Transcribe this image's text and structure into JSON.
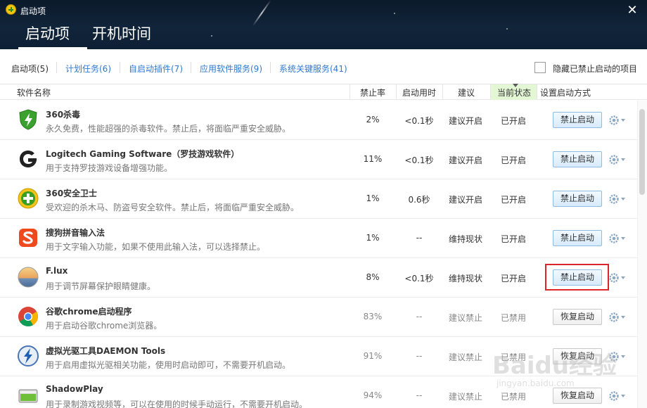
{
  "window": {
    "title": "启动项",
    "tabs": [
      {
        "label": "启动项",
        "active": true
      },
      {
        "label": "开机时间",
        "active": false
      }
    ]
  },
  "subtabs": [
    {
      "label": "启动项(5)",
      "active": true
    },
    {
      "label": "计划任务(6)",
      "active": false
    },
    {
      "label": "自启动插件(7)",
      "active": false
    },
    {
      "label": "应用软件服务(9)",
      "active": false
    },
    {
      "label": "系统关键服务(41)",
      "active": false
    }
  ],
  "hide_disabled": {
    "label": "隐藏已禁止启动的项目",
    "checked": false
  },
  "columns": {
    "name": "软件名称",
    "rate": "禁止率",
    "time": "启动用时",
    "advice": "建议",
    "state": "当前状态",
    "action": "设置启动方式"
  },
  "rows": [
    {
      "name": "360杀毒",
      "desc": "永久免费，性能超强的杀毒软件。禁止后，将面临严重安全威胁。",
      "rate": "2%",
      "time": "<0.1秒",
      "advice": "建议开启",
      "state": "已开启",
      "action": "禁止启动",
      "icon": "shield-icon",
      "enabled": true
    },
    {
      "name": "Logitech Gaming Software（罗技游戏软件）",
      "desc": "用于支持罗技游戏设备增强功能。",
      "rate": "11%",
      "time": "<0.1秒",
      "advice": "建议开启",
      "state": "已开启",
      "action": "禁止启动",
      "icon": "logitech-g-icon",
      "enabled": true
    },
    {
      "name": "360安全卫士",
      "desc": "受欢迎的杀木马、防盗号安全软件。禁止后，将面临严重安全威胁。",
      "rate": "1%",
      "time": "0.6秒",
      "advice": "建议开启",
      "state": "已开启",
      "action": "禁止启动",
      "icon": "360-safeguard-icon",
      "enabled": true
    },
    {
      "name": "搜狗拼音输入法",
      "desc": "用于文字输入功能，如果不使用此输入法，可以选择禁止。",
      "rate": "1%",
      "time": "--",
      "advice": "维持现状",
      "state": "已开启",
      "action": "禁止启动",
      "icon": "sogou-icon",
      "enabled": true
    },
    {
      "name": "F.lux",
      "desc": "用于调节屏幕保护眼睛健康。",
      "rate": "8%",
      "time": "<0.1秒",
      "advice": "维持现状",
      "state": "已开启",
      "action": "禁止启动",
      "icon": "flux-icon",
      "enabled": true,
      "highlighted": true
    },
    {
      "name": "谷歌chrome启动程序",
      "desc": "用于启动谷歌chrome浏览器。",
      "rate": "83%",
      "time": "--",
      "advice": "建议禁止",
      "state": "已禁用",
      "action": "恢复启动",
      "icon": "chrome-icon",
      "enabled": false
    },
    {
      "name": "虚拟光驱工具DAEMON Tools",
      "desc": "用于启用虚拟光驱相关功能，使用时启动即可，不需要开机启动。",
      "rate": "91%",
      "time": "--",
      "advice": "建议禁止",
      "state": "已禁用",
      "action": "恢复启动",
      "icon": "daemon-tools-icon",
      "enabled": false
    },
    {
      "name": "ShadowPlay",
      "desc": "用于录制游戏视频等，可以在使用的时候手动运行，不需要开机启动。",
      "rate": "94%",
      "time": "--",
      "advice": "建议禁止",
      "state": "已禁用",
      "action": "恢复启动",
      "icon": "shadowplay-icon",
      "enabled": false
    }
  ],
  "watermark": {
    "main": "Baidu经验",
    "sub": "jingyan.baidu.com"
  }
}
